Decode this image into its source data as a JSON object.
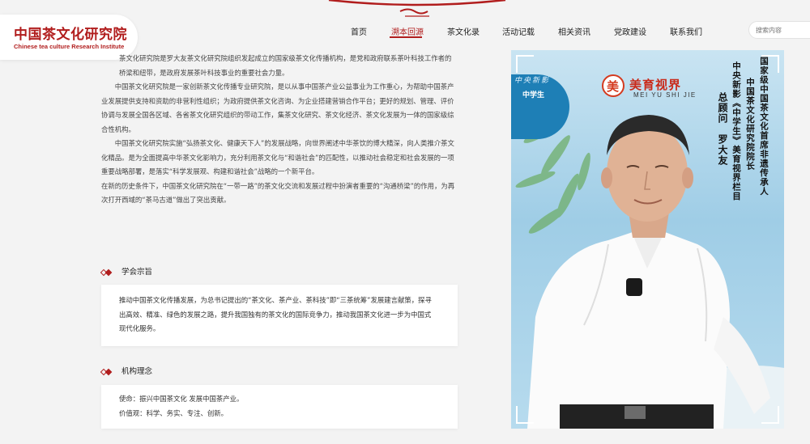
{
  "logo": {
    "cn": "中国茶文化研究院",
    "en": "Chinese tea culture Research Institute"
  },
  "nav": {
    "items": [
      {
        "label": "首页"
      },
      {
        "label": "溯本回源"
      },
      {
        "label": "茶文化录"
      },
      {
        "label": "活动记载"
      },
      {
        "label": "相关资讯"
      },
      {
        "label": "党政建设"
      },
      {
        "label": "联系我们"
      }
    ],
    "active_index": 1
  },
  "search": {
    "placeholder": "搜索内容"
  },
  "intro": {
    "p1": "茶文化研究院是罗大友茶文化研究院组织发起成立的国家级茶文化传播机构，是党和政府联系茶叶科技工作者的桥梁和纽带，是政府发展茶叶科技事业的重要社会力量。",
    "p2": "中国茶文化研究院是一家创新茶文化传播专业研究院，是以从事中国茶产业公益事业为工作重心，为帮助中国茶产业发展提供支持和资助的非营利性组织；为政府提供茶文化咨询、为企业搭建营销合作平台；更好的规划、管理、评价协调与发展全国各区域、各省茶文化研究组织的带动工作，集茶文化研究、茶文化经济、茶文化发展为一体的国家级综合性机构。",
    "p3": "中国茶文化研究院实施“弘扬茶文化、健康天下人”的发展战略，向世界阐述中华茶饮的博大精深，向人类推介茶文化精品。是为全面提高中华茶文化影响力，充分利用茶文化与“和谐社会”的匹配性，以推动社会稳定和社会发展的一项重要战略部署，是落实“科学发展观、构建和谐社会”战略的一个新平台。",
    "p4": "在新的历史条件下，中国茶文化研究院在“一带一路”的茶文化交流和发展过程中扮演者重要的“沟通桥梁”的作用，为再次打开西域的“茶马古道”做出了突出贡献。"
  },
  "section1": {
    "title": "学会宗旨",
    "text": "推动中国茶文化传播发展，为总书记提出的“茶文化、茶产业、茶科技”即“三茶统筹”发展建言献策，探寻出高效、精准、绿色的发展之路，提升我国独有的茶文化的国际竞争力，推动我国茶文化进一步为中国式现代化服务。"
  },
  "section2": {
    "title": "机构理念",
    "mission": "使命：振兴中国茶文化 发展中国茶产业。",
    "values": "价值观：科学、务实、专注、创新。"
  },
  "photo": {
    "brand_cn": "美育视界",
    "brand_en": "MEI YU SHI JIE",
    "logo_glyph": "美",
    "banner_script": "中央新影",
    "banner_label": "中学生",
    "col1": "国家级中国茶文化首席非遗传承人",
    "col2": "中国茶文化研究院院长",
    "col3": "中央新影《中学生》美育视界栏目",
    "col4": "总顾问　罗大友"
  },
  "colors": {
    "brand_red": "#b11d1d",
    "page_bg": "#f3f3f3"
  }
}
